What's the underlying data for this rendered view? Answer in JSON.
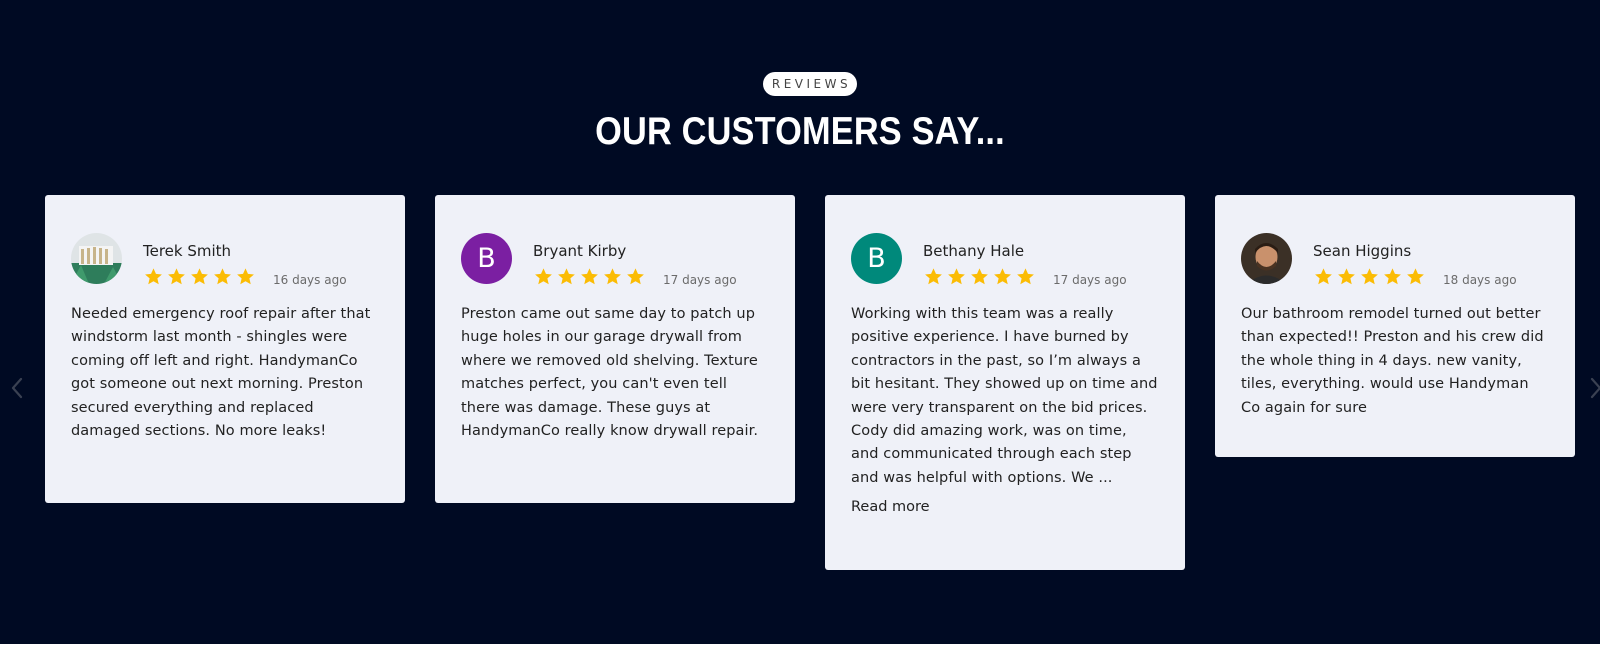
{
  "section": {
    "label": "REVIEWS",
    "title": "OUR CUSTOMERS SAY..."
  },
  "colors": {
    "background": "#000a23",
    "card": "#eff1f8",
    "star": "#fbbc04",
    "avatar_bryant": "#7b1fa2",
    "avatar_bethany": "#00897b"
  },
  "reviews": [
    {
      "name": "Terek Smith",
      "avatar": "photo-avatar",
      "rating": 5,
      "date": "16 days ago",
      "text": "Needed emergency roof repair after that windstorm last month - shingles were coming off left and right. HandymanCo got someone out next morning. Preston secured everything and replaced damaged sections. No more leaks!"
    },
    {
      "name": "Bryant Kirby",
      "avatar_letter": "B",
      "rating": 5,
      "date": "17 days ago",
      "text": "Preston came out same day to patch up huge holes in our garage drywall from where we removed old shelving. Texture matches perfect, you can't even tell there was damage. These guys at HandymanCo really know drywall repair."
    },
    {
      "name": "Bethany Hale",
      "avatar_letter": "B",
      "rating": 5,
      "date": "17 days ago",
      "text": "Working with this team was a really positive experience. I have burned by contractors in the past, so I’m always a bit hesitant. They showed up on time and were very transparent on the bid prices. Cody did amazing work, was on time, and communicated through each step and was helpful with options. We ...",
      "read_more": "Read more"
    },
    {
      "name": "Sean Higgins",
      "avatar": "photo-avatar",
      "rating": 5,
      "date": "18 days ago",
      "text": "Our bathroom remodel turned out better than expected!! Preston and his crew did the whole thing in 4 days. new vanity, tiles, everything. would use Handyman Co again for sure"
    }
  ],
  "icons": {
    "prev": "chevron-left-icon",
    "next": "chevron-right-icon",
    "star": "star-icon"
  }
}
